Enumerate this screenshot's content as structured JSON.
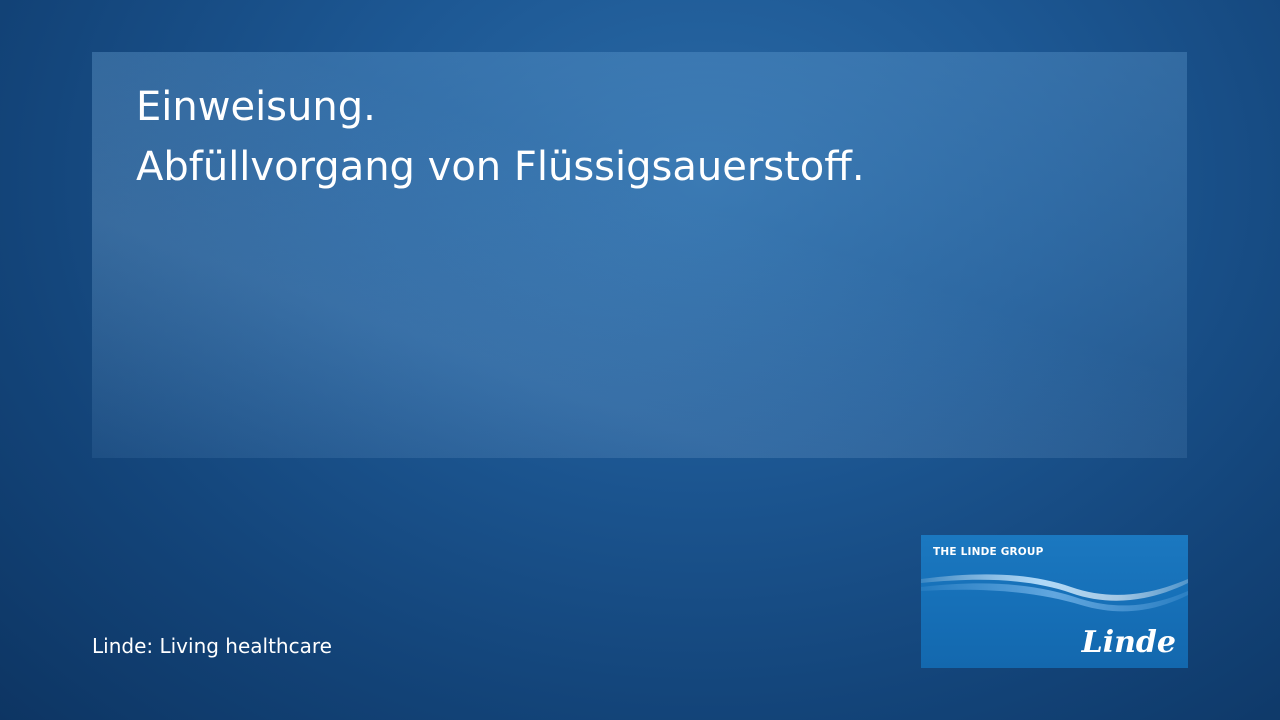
{
  "title": {
    "line1": "Einweisung.",
    "line2": "Abfüllvorgang von Flüssigsauerstoff."
  },
  "footer": {
    "tagline": "Linde: Living healthcare"
  },
  "logo": {
    "group_text": "THE LINDE GROUP",
    "wordmark": "Linde"
  },
  "colors": {
    "background": "#1a5190",
    "logo_blue": "#1670b8",
    "text": "#ffffff"
  }
}
